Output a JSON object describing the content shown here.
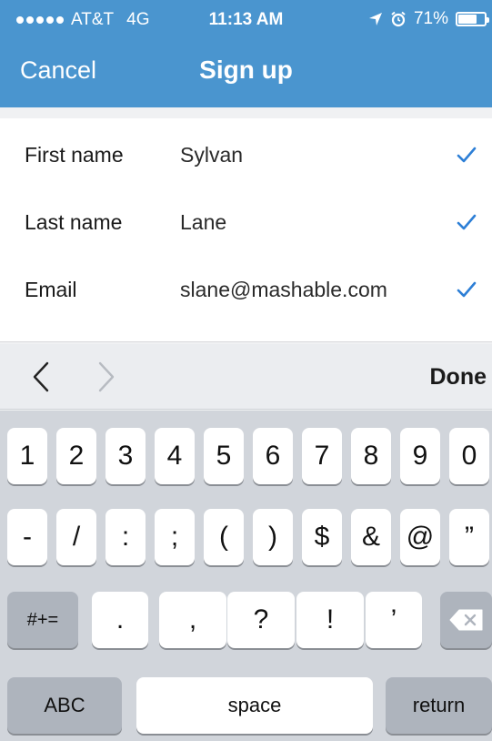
{
  "status_bar": {
    "carrier": "AT&T",
    "network": "4G",
    "time": "11:13 AM",
    "battery": "71%",
    "battery_level": 0.71
  },
  "nav": {
    "cancel_label": "Cancel",
    "title": "Sign up"
  },
  "form": {
    "rows": [
      {
        "label": "First name",
        "value": "Sylvan"
      },
      {
        "label": "Last name",
        "value": "Lane"
      },
      {
        "label": "Email",
        "value": "slane@mashable.com"
      }
    ]
  },
  "accessory": {
    "done_label": "Done"
  },
  "keyboard": {
    "row1": [
      "1",
      "2",
      "3",
      "4",
      "5",
      "6",
      "7",
      "8",
      "9",
      "0"
    ],
    "row2": [
      "-",
      "/",
      ":",
      ";",
      "(",
      ")",
      "$",
      "&",
      "@",
      "”"
    ],
    "row3": {
      "switch_label": "#+=",
      "keys": [
        ".",
        ",",
        "?",
        "!",
        "’"
      ]
    },
    "row4": {
      "abc_label": "ABC",
      "space_label": "space",
      "return_label": "return"
    }
  },
  "colors": {
    "header_bg": "#4a95cf",
    "checkmark": "#2d7fd6",
    "keyboard_bg": "#d1d5db"
  },
  "icons": [
    "location-arrow-icon",
    "alarm-icon",
    "battery-icon",
    "checkmark-icon",
    "chevron-left-icon",
    "chevron-right-icon",
    "delete-key-icon"
  ]
}
